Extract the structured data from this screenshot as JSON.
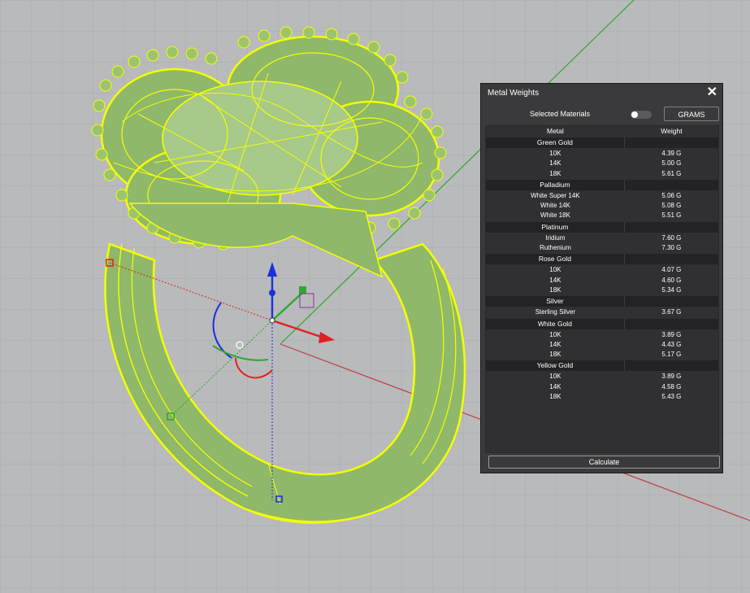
{
  "panel": {
    "title": "Metal Weights",
    "close_glyph": "✕",
    "selected_materials_label": "Selected Materials",
    "units_button": "GRAMS",
    "calculate_label": "Calculate",
    "headers": {
      "metal": "Metal",
      "weight": "Weight"
    },
    "groups": [
      {
        "name": "Green Gold",
        "rows": [
          {
            "metal": "10K",
            "weight": "4.39 G"
          },
          {
            "metal": "14K",
            "weight": "5.00 G"
          },
          {
            "metal": "18K",
            "weight": "5.61 G"
          }
        ]
      },
      {
        "name": "Palladium",
        "rows": [
          {
            "metal": "White Super 14K",
            "weight": "5.06 G"
          },
          {
            "metal": "White 14K",
            "weight": "5.08 G"
          },
          {
            "metal": "White 18K",
            "weight": "5.51 G"
          }
        ]
      },
      {
        "name": "Platinum",
        "rows": [
          {
            "metal": "Iridium",
            "weight": "7.60 G"
          },
          {
            "metal": "Ruthenium",
            "weight": "7.30 G"
          }
        ]
      },
      {
        "name": "Rose Gold",
        "rows": [
          {
            "metal": "10K",
            "weight": "4.07 G"
          },
          {
            "metal": "14K",
            "weight": "4.60 G"
          },
          {
            "metal": "18K",
            "weight": "5.34 G"
          }
        ]
      },
      {
        "name": "Silver",
        "rows": [
          {
            "metal": "Sterling Silver",
            "weight": "3.67 G"
          }
        ]
      },
      {
        "name": "White Gold",
        "rows": [
          {
            "metal": "10K",
            "weight": "3.89 G"
          },
          {
            "metal": "14K",
            "weight": "4.43 G"
          },
          {
            "metal": "18K",
            "weight": "5.17 G"
          }
        ]
      },
      {
        "name": "Yellow Gold",
        "rows": [
          {
            "metal": "10K",
            "weight": "3.89 G"
          },
          {
            "metal": "14K",
            "weight": "4.58 G"
          },
          {
            "metal": "18K",
            "weight": "5.43 G"
          }
        ]
      }
    ]
  },
  "viewport": {
    "background": "#b9babc",
    "ring_fill": "#8fb86a",
    "wireframe": "#f2ff00",
    "axis_x": "#e02020",
    "axis_y": "#2ea82e",
    "axis_z": "#1a2fe0"
  }
}
